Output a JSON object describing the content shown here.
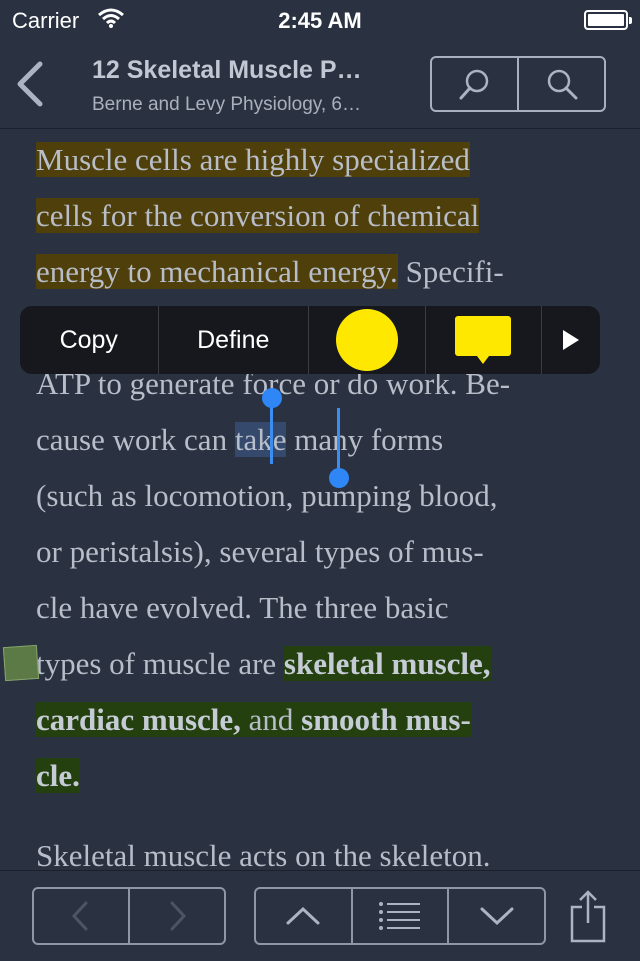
{
  "status_bar": {
    "carrier": "Carrier",
    "time": "2:45 AM"
  },
  "nav": {
    "title": "12 Skeletal Muscle P…",
    "subtitle": "Berne and Levy Physiology, 6…"
  },
  "content": {
    "lines": [
      {
        "parts": [
          "Muscle cells are highly specialized"
        ]
      },
      {
        "parts": [
          "cells for the conversion of chemical"
        ]
      },
      {
        "parts": [
          "energy to mechanical energy.",
          " Specifi-"
        ]
      },
      {
        "parts": [
          "ATP to generate force or do work.  Be-"
        ]
      },
      {
        "parts": [
          "cause work can ",
          "take",
          " many forms"
        ]
      },
      {
        "parts": [
          "(such as locomotion,  pumping blood,"
        ]
      },
      {
        "parts": [
          "or peristalsis),  several types of mus-"
        ]
      },
      {
        "parts": [
          "cle have evolved.  The three basic"
        ]
      },
      {
        "parts": [
          "types of muscle are ",
          "skeletal muscle,"
        ]
      },
      {
        "parts": [
          "cardiac muscle,",
          " and ",
          "smooth mus-"
        ]
      },
      {
        "parts": [
          "cle."
        ]
      },
      {
        "parts": [
          "Skeletal muscle acts on the skeleton."
        ]
      }
    ]
  },
  "popup": {
    "copy": "Copy",
    "define": "Define"
  },
  "colors": {
    "background": "#2a3140",
    "highlight_yellow": "#4f3f0b",
    "highlight_green": "#24400f",
    "selection": "#34496c",
    "handle": "#2f86f6",
    "menu_highlight_swatch": "#ffe800",
    "menu_note_swatch": "#ffe800"
  },
  "icons": {
    "back": "chevron-left-icon",
    "search_book": "search-icon",
    "search_all": "search-icon",
    "prev_page": "chevron-left-icon",
    "next_page": "chevron-right-icon",
    "prev_section": "chevron-up-icon",
    "toc": "list-icon",
    "next_section": "chevron-down-icon",
    "share": "share-icon"
  }
}
